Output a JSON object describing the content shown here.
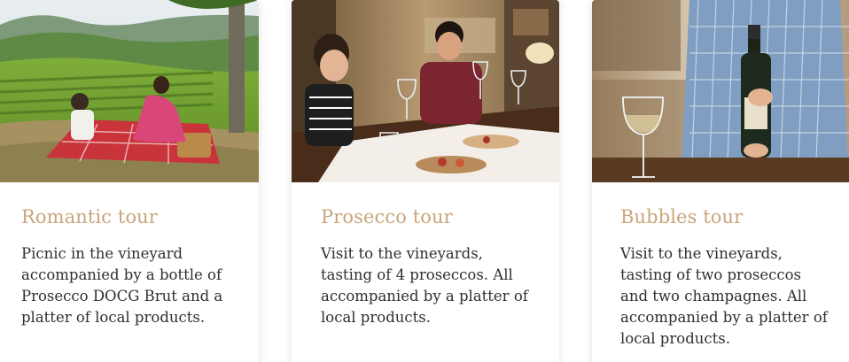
{
  "tours": [
    {
      "title": "Romantic tour",
      "description": "Picnic in the vineyard accompanied by a bottle of Prosecco DOCG Brut and a platter of local products.",
      "image": "picnic-in-vineyard-photo"
    },
    {
      "title": "Prosecco tour",
      "description": "Visit to the vineyards, tasting of 4 proseccos. All accompanied by a platter of local products.",
      "image": "wine-tasting-photo"
    },
    {
      "title": "Bubbles tour",
      "description": "Visit to the vineyards, tasting of two proseccos and two champagnes. All accompanied by a platter of local products.",
      "image": "champagne-bottle-photo"
    }
  ]
}
